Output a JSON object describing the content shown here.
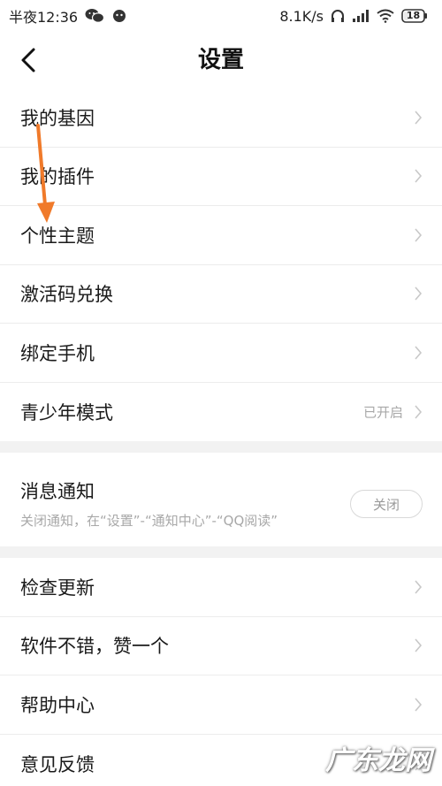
{
  "status_bar": {
    "time": "半夜12:36",
    "network_speed": "8.1K/s",
    "battery": "18",
    "icons": [
      "wechat-icon",
      "qq-icon",
      "headphones-icon",
      "signal-icon",
      "wifi-icon",
      "battery-icon"
    ]
  },
  "nav": {
    "title": "设置",
    "back_icon": "back-arrow-icon"
  },
  "group1": {
    "items": [
      {
        "label": "我的基因"
      },
      {
        "label": "我的插件"
      },
      {
        "label": "个性主题"
      },
      {
        "label": "激活码兑换"
      },
      {
        "label": "绑定手机"
      },
      {
        "label": "青少年模式",
        "value": "已开启"
      }
    ]
  },
  "notification": {
    "title": "消息通知",
    "subtitle": "关闭通知，在“设置”-“通知中心”-“QQ阅读”",
    "button_label": "关闭"
  },
  "group3": {
    "items": [
      {
        "label": "检查更新"
      },
      {
        "label": "软件不错，赞一个"
      },
      {
        "label": "帮助中心"
      },
      {
        "label": "意见反馈"
      }
    ]
  },
  "annotation": {
    "arrow_color": "#f07a2a"
  },
  "watermark": {
    "text": "广东龙网"
  },
  "colors": {
    "background": "#f2f2f2",
    "text": "#1a1a1a",
    "secondary_text": "#a8a8a8",
    "chevron": "#c8c8c8"
  }
}
